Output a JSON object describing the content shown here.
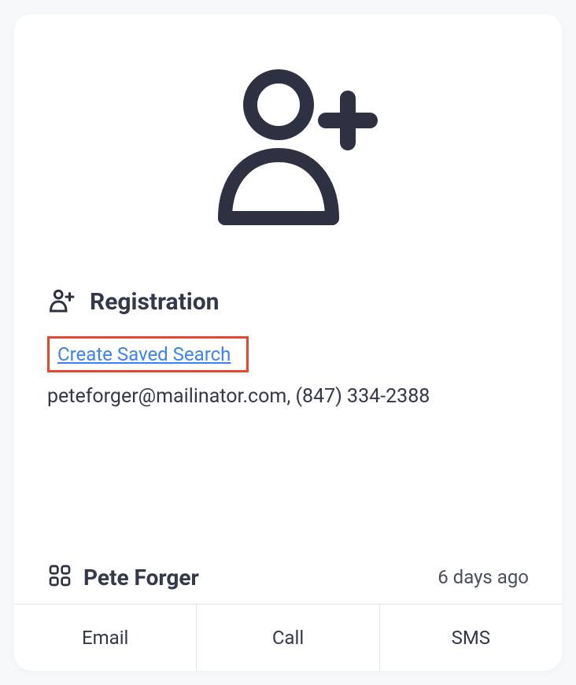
{
  "header": {
    "title": "Registration"
  },
  "link": {
    "label": "Create Saved Search"
  },
  "contact": {
    "line": "peteforger@mailinator.com, (847) 334-2388"
  },
  "lead": {
    "name": "Pete Forger",
    "timestamp": "6 days ago"
  },
  "actions": {
    "email": "Email",
    "call": "Call",
    "sms": "SMS"
  },
  "colors": {
    "highlight_border": "#e9452f",
    "link": "#3b82f6",
    "text": "#33384a"
  }
}
